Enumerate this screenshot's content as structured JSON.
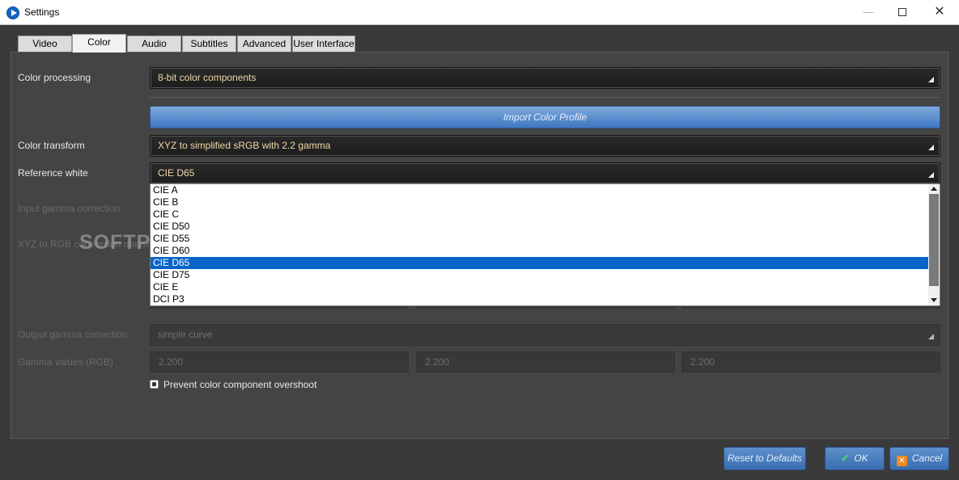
{
  "window": {
    "title": "Settings",
    "minimize": "—",
    "close": "✕"
  },
  "tabs": [
    {
      "label": "Video"
    },
    {
      "label": "Color"
    },
    {
      "label": "Audio"
    },
    {
      "label": "Subtitles"
    },
    {
      "label": "Advanced"
    },
    {
      "label": "User Interface"
    }
  ],
  "active_tab": "Color",
  "color_processing": {
    "label": "Color processing",
    "value": "8-bit color components"
  },
  "import_button": "Import Color Profile",
  "color_transform": {
    "label": "Color transform",
    "value": "XYZ to simplified sRGB with 2.2 gamma"
  },
  "reference_white": {
    "label": "Reference white",
    "value": "CIE D65",
    "options": [
      "CIE A",
      "CIE B",
      "CIE C",
      "CIE D50",
      "CIE D55",
      "CIE D60",
      "CIE D65",
      "CIE D75",
      "CIE E",
      "DCI P3"
    ],
    "selected_index": 6
  },
  "input_gamma": {
    "label": "Input gamma correction"
  },
  "xyz_matrix": {
    "label": "XYZ to RGB conversion matrix"
  },
  "output_gamma": {
    "label": "Output gamma correction",
    "value": "simple curve"
  },
  "gamma_values": {
    "label": "Gamma values (RGB)",
    "r": "2.200",
    "g": "2.200",
    "b": "2.200"
  },
  "prevent_overshoot": {
    "label": "Prevent color component overshoot",
    "checked": true
  },
  "footer": {
    "reset": "Reset to Defaults",
    "ok": "OK",
    "cancel": "Cancel",
    "ok_icon": "✔",
    "cancel_icon": "✕"
  },
  "watermark": "SOFTPEDIA",
  "colors": {
    "accent": "#0a64c8",
    "button": "#3e78c2",
    "panel": "#444444",
    "value_text": "#f0d8a8"
  }
}
